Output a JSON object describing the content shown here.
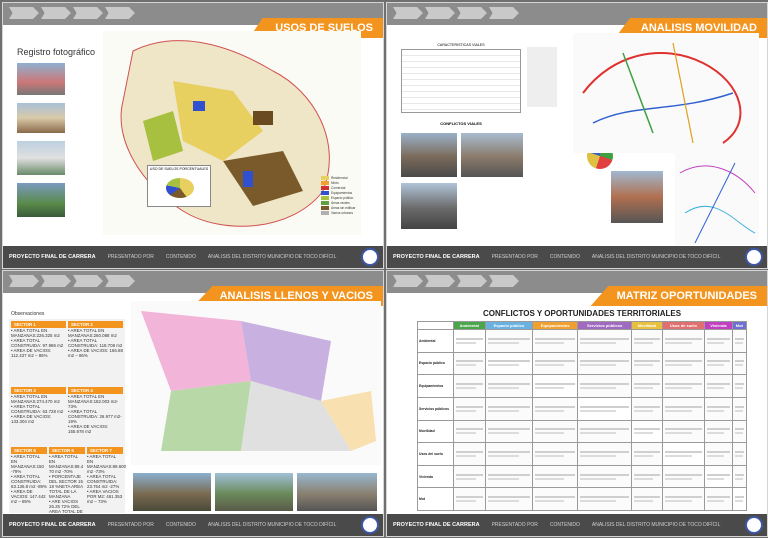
{
  "panels": {
    "usos": {
      "title": "USOS DE SUELOS",
      "photo_title": "Registro fotográfico",
      "chart_title": "USO DE SUELOS PORCENTUALES",
      "legend": [
        "Residencial",
        "Mixto",
        "Comercial",
        "Equipamientos",
        "Espacio público",
        "Áreas verdes",
        "Áreas sin edificar",
        "Vacíos urbanos"
      ]
    },
    "movilidad": {
      "title": "ANALISIS MOVILIDAD",
      "table_title": "CARACTERISTICAS VIALES",
      "conflicts_title": "CONFLICTOS VIALES"
    },
    "llenos": {
      "title": "ANALISIS LLENOS Y VACIOS",
      "observaciones": "Observaciones",
      "sectors": [
        {
          "name": "SECTOR 1",
          "lines": [
            "• AREA TOTAL EN MANZANAS:226.325 m2",
            "• AREA TOTAL CONSTRUIDA: 97.986 m2",
            "• AREA DE VACIOS: 112.437 m2 – 86%"
          ]
        },
        {
          "name": "SECTOR 2",
          "lines": [
            "• AREA TOTAL EN MANZANAS:260.088 m2",
            "• AREA TOTAL CONSTRUIDA: 118.708 m2",
            "• AREA DE VACIOS: 166.88 m2 – 86%"
          ]
        },
        {
          "name": "SECTOR 3",
          "lines": [
            "• AREA TOTAL EN MANZANAS:274.470 m2",
            "• AREA TOTAL CONSTRUIDA: 63.728 m2",
            "• AREA DE VACIOS: 133.304 m2"
          ]
        },
        {
          "name": "SECTOR 4",
          "lines": [
            "• AREA TOTAL EN MANZANAS:182.003 m2-73%",
            "• AREA TOTAL CONSTRUIDA: 26.977 m2-19%",
            "• AREA DE VACIOS: 155.978 m2"
          ]
        },
        {
          "name": "SECTOR 5",
          "lines": [
            "• AREA TOTAL EN MANZANAS:150 -79%",
            "• AREA TOTAL CONSTRUIDA: 63.136.8 m2 -89%",
            "• AREA DE VACIOS: 147.442 m2 – 89%"
          ]
        },
        {
          "name": "SECTOR 6",
          "lines": [
            "• AREA TOTAL EN MANZANAS:89.4 70 m2 -70%",
            "• PORCENTAJE DEL SECTOR 15 18 %NETA AREA TOTAL DE LA MANZANA",
            "• ARE VACIOS 26.25 72% DEL AREA TOTAL DE LAS M2"
          ]
        },
        {
          "name": "SECTOR 7",
          "lines": [
            "• AREA TOTAL EN MANZANAS:89.600 m2 -73%",
            "• AREA TOTAL CONSTRUIDA: 23.764 m2 -27%",
            "• AREA VACIOS POR M2: 461.353 m2 – 73%"
          ]
        }
      ]
    },
    "matriz": {
      "title": "MATRIZ OPORTUNIDADES",
      "table_title": "CONFLICTOS Y OPORTUNIDADES  TERRITORIALES",
      "headers": [
        "Ambiental",
        "Espacio público",
        "Equipamientos",
        "Servicios públicos",
        "Movilidad",
        "Usos de suelo",
        "Vivienda",
        "Mot"
      ],
      "header_colors": [
        "#4aa64a",
        "#6ab0e0",
        "#f0a030",
        "#a06ac0",
        "#e8c040",
        "#e07070",
        "#c040c0",
        "#7070d0"
      ],
      "rows": [
        "Ambiental",
        "Espacio público",
        "Equipamientos",
        "Servicios públicos",
        "Movilidad",
        "Usos del suelo",
        "Vivienda",
        "Mot"
      ]
    }
  },
  "footer": {
    "project": "PROYECTO FINAL DE CARRERA",
    "presentado": "PRESENTADO POR",
    "contenido": "CONTENIDO",
    "tema": "ANALISIS DEL DISTRITO MUNICIPIO DE TOCO DIFÍCIL"
  }
}
